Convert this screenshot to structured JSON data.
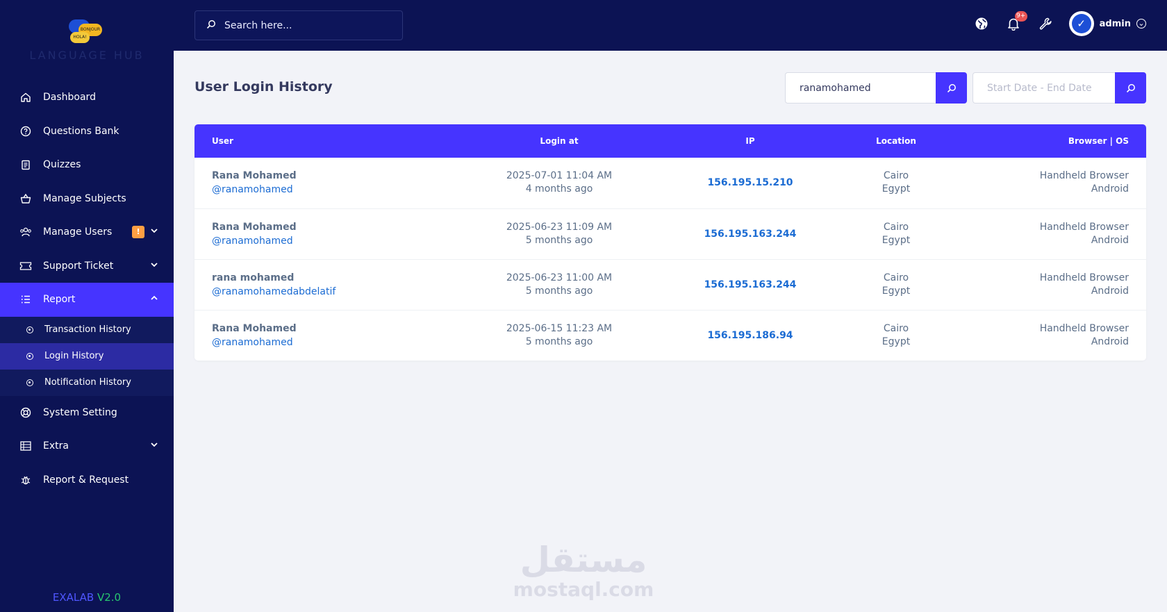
{
  "logo": {
    "text": "LANGUAGE HUB",
    "bubble_a": "BONJOUR",
    "bubble_b": "HOLA!"
  },
  "sidebar": {
    "items": [
      {
        "label": "Dashboard",
        "icon": "home-icon"
      },
      {
        "label": "Questions Bank",
        "icon": "question-circle-icon"
      },
      {
        "label": "Quizzes",
        "icon": "clipboard-icon"
      },
      {
        "label": "Manage Subjects",
        "icon": "basket-icon"
      },
      {
        "label": "Manage Users",
        "icon": "users-icon",
        "badge": "!"
      },
      {
        "label": "Support Ticket",
        "icon": "ticket-icon"
      },
      {
        "label": "Report",
        "icon": "list-icon"
      },
      {
        "label": "System Setting",
        "icon": "lifebuoy-icon"
      },
      {
        "label": "Extra",
        "icon": "server-icon"
      },
      {
        "label": "Report & Request",
        "icon": "bug-icon"
      }
    ],
    "report_submenu": [
      {
        "label": "Transaction History"
      },
      {
        "label": "Login History"
      },
      {
        "label": "Notification History"
      }
    ],
    "version_name": "EXALAB",
    "version_number": "V2.0"
  },
  "topbar": {
    "search_placeholder": "Search here...",
    "notification_count": "9+",
    "admin_name": "admin"
  },
  "page": {
    "title": "User Login History",
    "username_filter_value": "ranamohamed",
    "date_filter_placeholder": "Start Date - End Date"
  },
  "table": {
    "headers": {
      "user": "User",
      "login_at": "Login at",
      "ip": "IP",
      "location": "Location",
      "browser": "Browser | OS"
    },
    "rows": [
      {
        "name": "Rana Mohamed",
        "handle": "@ranamohamed",
        "login_at": "2025-07-01 11:04 AM",
        "ago": "4 months ago",
        "ip": "156.195.15.210",
        "city": "Cairo",
        "country": "Egypt",
        "browser": "Handheld Browser",
        "os": "Android"
      },
      {
        "name": "Rana Mohamed",
        "handle": "@ranamohamed",
        "login_at": "2025-06-23 11:09 AM",
        "ago": "5 months ago",
        "ip": "156.195.163.244",
        "city": "Cairo",
        "country": "Egypt",
        "browser": "Handheld Browser",
        "os": "Android"
      },
      {
        "name": "rana mohamed",
        "handle": "@ranamohamedabdelatif",
        "login_at": "2025-06-23 11:00 AM",
        "ago": "5 months ago",
        "ip": "156.195.163.244",
        "city": "Cairo",
        "country": "Egypt",
        "browser": "Handheld Browser",
        "os": "Android"
      },
      {
        "name": "Rana Mohamed",
        "handle": "@ranamohamed",
        "login_at": "2025-06-15 11:23 AM",
        "ago": "5 months ago",
        "ip": "156.195.186.94",
        "city": "Cairo",
        "country": "Egypt",
        "browser": "Handheld Browser",
        "os": "Android"
      }
    ]
  },
  "watermark": {
    "arabic": "مستقل",
    "latin": "mostaql.com"
  },
  "colors": {
    "sidebar_bg": "#0c1354",
    "accent": "#4634ff",
    "link": "#1c6cd3",
    "warning": "#ff9f43",
    "danger": "#ea5455"
  }
}
